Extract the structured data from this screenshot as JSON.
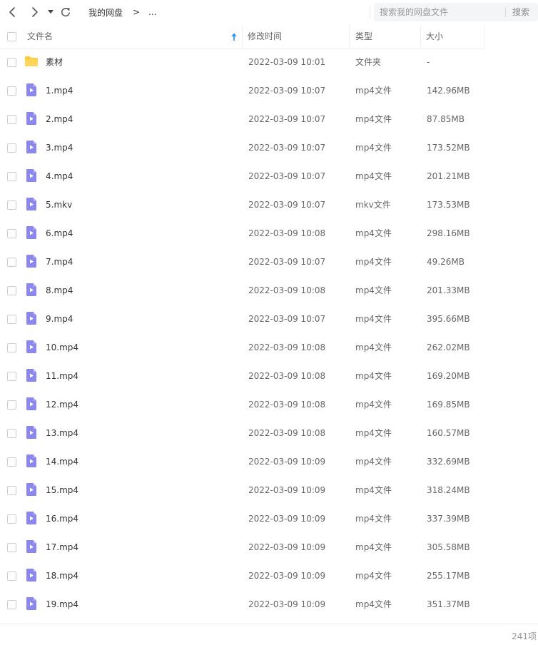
{
  "nav": {
    "back_icon": "chevron-left-icon",
    "forward_icon": "chevron-right-icon",
    "history_icon": "caret-down-icon",
    "refresh_icon": "refresh-icon"
  },
  "breadcrumb": {
    "root": "我的网盘",
    "separator": ">",
    "ellipsis": "..."
  },
  "search": {
    "placeholder": "搜索我的网盘文件",
    "value": "",
    "button_label": "搜索"
  },
  "table": {
    "headers": {
      "name": "文件名",
      "modified": "修改时间",
      "type": "类型",
      "size": "大小"
    },
    "sort": {
      "column": "name",
      "direction": "ascending",
      "icon": "sort-arrow-up-icon"
    },
    "rows": [
      {
        "name": "素材",
        "modified": "2022-03-09 10:01",
        "type": "文件夹",
        "size": "-",
        "icon": "folder-icon"
      },
      {
        "name": "1.mp4",
        "modified": "2022-03-09 10:07",
        "type": "mp4文件",
        "size": "142.96MB",
        "icon": "video-file-icon"
      },
      {
        "name": "2.mp4",
        "modified": "2022-03-09 10:07",
        "type": "mp4文件",
        "size": "87.85MB",
        "icon": "video-file-icon"
      },
      {
        "name": "3.mp4",
        "modified": "2022-03-09 10:07",
        "type": "mp4文件",
        "size": "173.52MB",
        "icon": "video-file-icon"
      },
      {
        "name": "4.mp4",
        "modified": "2022-03-09 10:07",
        "type": "mp4文件",
        "size": "201.21MB",
        "icon": "video-file-icon"
      },
      {
        "name": "5.mkv",
        "modified": "2022-03-09 10:07",
        "type": "mkv文件",
        "size": "173.53MB",
        "icon": "video-file-icon"
      },
      {
        "name": "6.mp4",
        "modified": "2022-03-09 10:08",
        "type": "mp4文件",
        "size": "298.16MB",
        "icon": "video-file-icon"
      },
      {
        "name": "7.mp4",
        "modified": "2022-03-09 10:07",
        "type": "mp4文件",
        "size": "49.26MB",
        "icon": "video-file-icon"
      },
      {
        "name": "8.mp4",
        "modified": "2022-03-09 10:08",
        "type": "mp4文件",
        "size": "201.33MB",
        "icon": "video-file-icon"
      },
      {
        "name": "9.mp4",
        "modified": "2022-03-09 10:07",
        "type": "mp4文件",
        "size": "395.66MB",
        "icon": "video-file-icon"
      },
      {
        "name": "10.mp4",
        "modified": "2022-03-09 10:08",
        "type": "mp4文件",
        "size": "262.02MB",
        "icon": "video-file-icon"
      },
      {
        "name": "11.mp4",
        "modified": "2022-03-09 10:08",
        "type": "mp4文件",
        "size": "169.20MB",
        "icon": "video-file-icon"
      },
      {
        "name": "12.mp4",
        "modified": "2022-03-09 10:08",
        "type": "mp4文件",
        "size": "169.85MB",
        "icon": "video-file-icon"
      },
      {
        "name": "13.mp4",
        "modified": "2022-03-09 10:08",
        "type": "mp4文件",
        "size": "160.57MB",
        "icon": "video-file-icon"
      },
      {
        "name": "14.mp4",
        "modified": "2022-03-09 10:09",
        "type": "mp4文件",
        "size": "332.69MB",
        "icon": "video-file-icon"
      },
      {
        "name": "15.mp4",
        "modified": "2022-03-09 10:09",
        "type": "mp4文件",
        "size": "318.24MB",
        "icon": "video-file-icon"
      },
      {
        "name": "16.mp4",
        "modified": "2022-03-09 10:09",
        "type": "mp4文件",
        "size": "337.39MB",
        "icon": "video-file-icon"
      },
      {
        "name": "17.mp4",
        "modified": "2022-03-09 10:09",
        "type": "mp4文件",
        "size": "305.58MB",
        "icon": "video-file-icon"
      },
      {
        "name": "18.mp4",
        "modified": "2022-03-09 10:09",
        "type": "mp4文件",
        "size": "255.17MB",
        "icon": "video-file-icon"
      },
      {
        "name": "19.mp4",
        "modified": "2022-03-09 10:09",
        "type": "mp4文件",
        "size": "351.37MB",
        "icon": "video-file-icon"
      }
    ]
  },
  "footer": {
    "item_count": "241项"
  },
  "colors": {
    "folder": "#FFCB3D",
    "video_file": "#8B86F0",
    "sort_arrow": "#1E90FF",
    "header_text": "#666666",
    "row_text": "#333333"
  }
}
